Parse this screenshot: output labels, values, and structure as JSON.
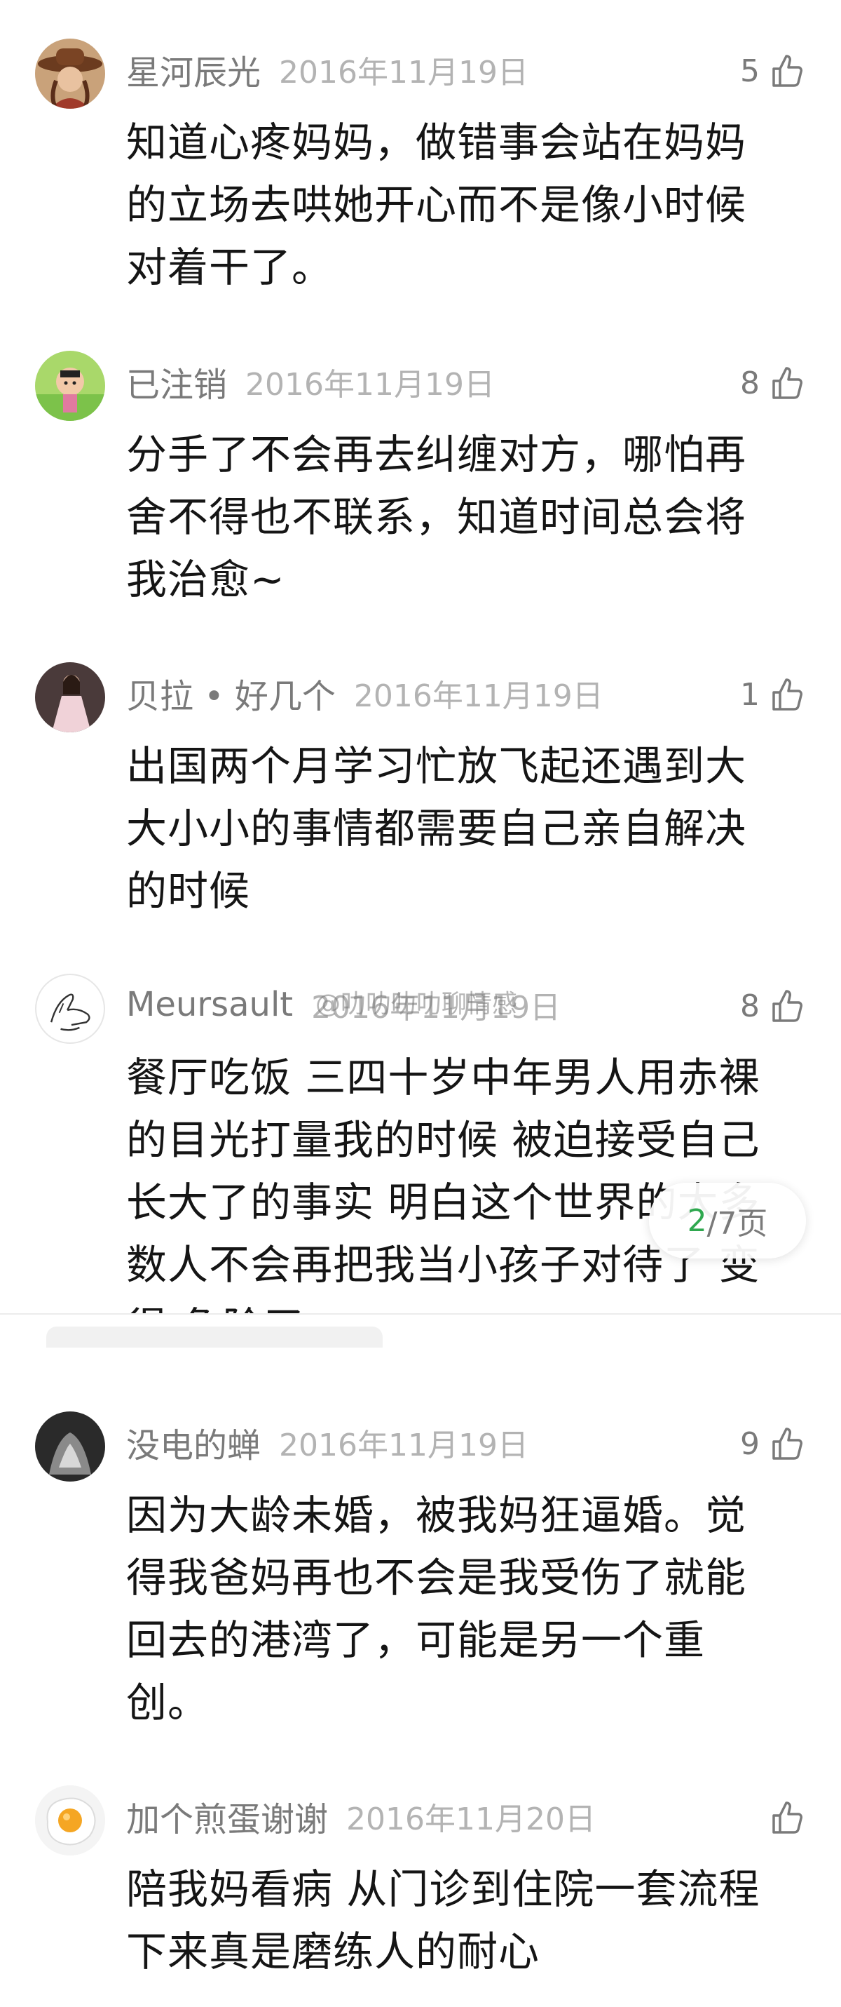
{
  "comments_upper": [
    {
      "username": "星河辰光",
      "date": "2016年11月19日",
      "likes": "5",
      "avatar_icon": "cowboy-hat-portrait",
      "lines": [
        "知道心疼妈妈，做错事会站在妈妈",
        "的立场去哄她开心而不是像小时候",
        "对着干了。"
      ]
    },
    {
      "username": "已注销",
      "date": "2016年11月19日",
      "likes": "8",
      "avatar_icon": "cartoon-character",
      "lines": [
        "分手了不会再去纠缠对方，哪怕再",
        "舍不得也不联系，知道时间总会将",
        "我治愈~"
      ]
    },
    {
      "username": "贝拉 • 好几个",
      "date": "2016年11月19日",
      "likes": "1",
      "avatar_icon": "woman-in-dress",
      "lines": [
        "出国两个月学习忙放飞起还遇到大",
        "大小小的事情都需要自己亲自解决",
        "的时候"
      ]
    },
    {
      "username": "Meursault",
      "date": "2016年11月19日",
      "likes": "8",
      "avatar_icon": "hands-line-drawing",
      "lines": [
        "餐厅吃饭 三四十岁中年男人用赤裸",
        "的目光打量我的时候 被迫接受自己",
        "长大了的事实 明白这个世界的大多",
        "数人不会再把我当小孩子对待了 变",
        "得 危险了"
      ]
    }
  ],
  "comments_lower": [
    {
      "username": "没电的蝉",
      "date": "2016年11月19日",
      "likes": "9",
      "avatar_icon": "dark-abstract",
      "lines": [
        "因为大龄未婚，被我妈狂逼婚。觉",
        "得我爸妈再也不会是我受伤了就能",
        "回去的港湾了，可能是另一个重",
        "创。"
      ]
    },
    {
      "username": "加个煎蛋谢谢",
      "date": "2016年11月20日",
      "likes": "",
      "avatar_icon": "fried-egg",
      "lines": [
        "陪我妈看病 从门诊到住院一套流程",
        "下来真是磨练人的耐心"
      ]
    }
  ],
  "watermark": "@叻叻叻叻聊情感",
  "pagination": {
    "current": "2",
    "rest": "/7页"
  },
  "colors": {
    "username": "#7a7a7a",
    "date": "#b3b3b3",
    "body_text": "#151515",
    "page_current": "#2fa84f"
  }
}
